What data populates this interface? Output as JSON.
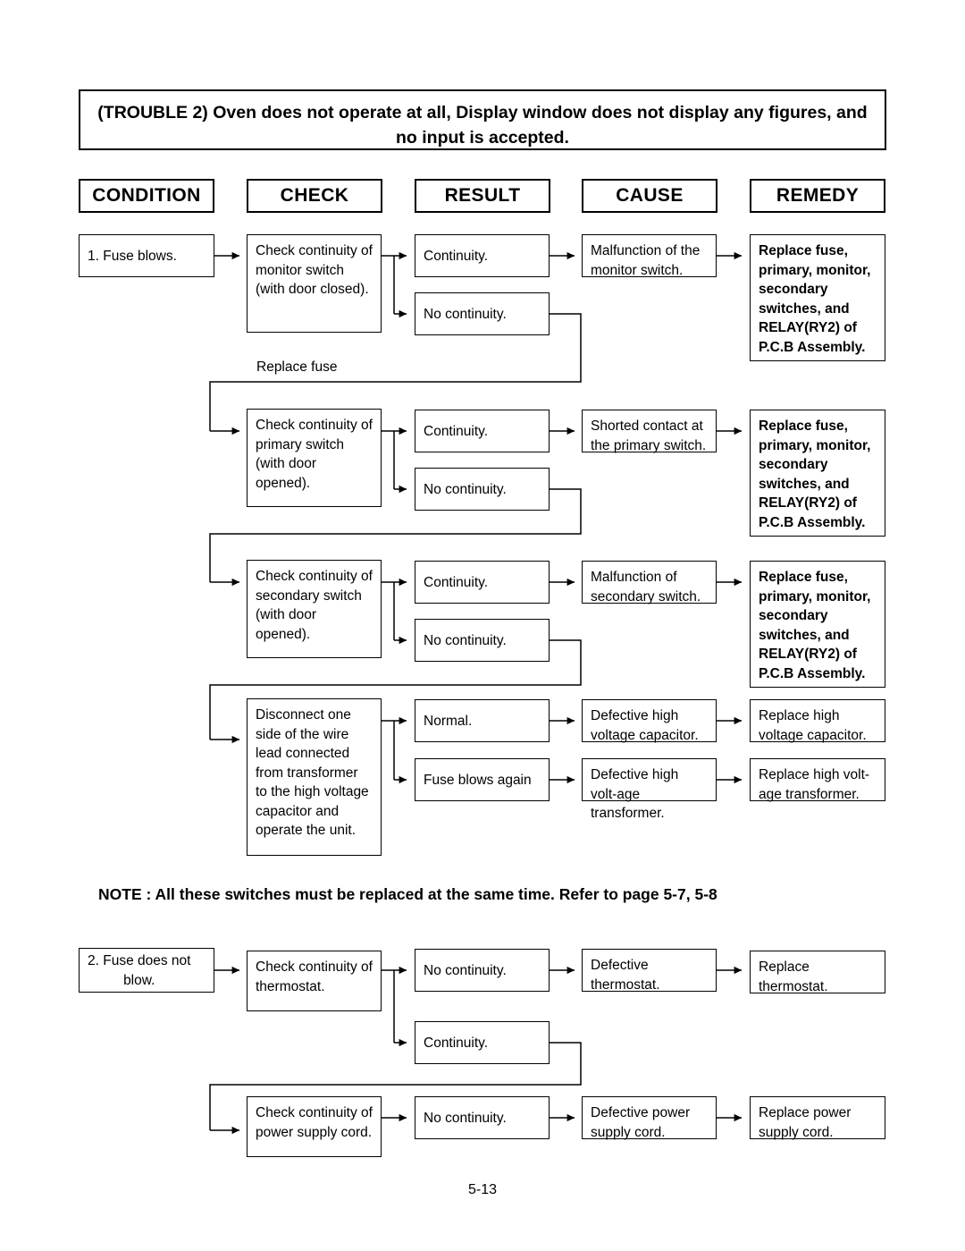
{
  "title": "(TROUBLE 2) Oven does not operate at all, Display window does not display any figures, and no input is accepted.",
  "headers": {
    "condition": "CONDITION",
    "check": "CHECK",
    "result": "RESULT",
    "cause": "CAUSE",
    "remedy": "REMEDY"
  },
  "remedy_switches": "Replace fuse, primary, monitor, secondary switches, and RELAY(RY2) of P.C.B Assembly.",
  "feedback_label": "Replace fuse",
  "note": "NOTE : All these switches must be replaced at the same time. Refer to page 5-7, 5-8",
  "page_number": "5-13",
  "flow": {
    "condition_1": "1. Fuse blows.",
    "condition_2": "2. Fuse does not\n      blow.",
    "rows": [
      {
        "check": "Check continuity of monitor switch (with door closed).",
        "result_top": "Continuity.",
        "result_bottom": "No continuity.",
        "cause": "Malfunction of the monitor switch.",
        "remedy": "Replace fuse, primary, monitor, secondary switches, and RELAY(RY2) of P.C.B Assembly."
      },
      {
        "check": "Check continuity of primary switch (with door opened).",
        "result_top": "Continuity.",
        "result_bottom": "No continuity.",
        "cause": "Shorted contact at the primary switch.",
        "remedy": "Replace fuse, primary, monitor, secondary switches, and RELAY(RY2) of P.C.B Assembly."
      },
      {
        "check": "Check continuity of secondary switch (with door opened).",
        "result_top": "Continuity.",
        "result_bottom": "No continuity.",
        "cause": "Malfunction of secondary switch.",
        "remedy": "Replace fuse, primary, monitor, secondary switches, and RELAY(RY2) of P.C.B Assembly."
      },
      {
        "check": "Disconnect one side of the wire lead connected from transformer to the high voltage capacitor and operate the unit.",
        "result_top": "Normal.",
        "result_bottom": "Fuse blows again",
        "cause_top": "Defective high voltage capacitor.",
        "cause_bottom": "Defective high volt-age transformer.",
        "remedy_top": "Replace high voltage capacitor.",
        "remedy_bottom": "Replace high volt-age transformer."
      },
      {
        "check": "Check continuity of thermostat.",
        "result_top": "No continuity.",
        "result_bottom": "Continuity.",
        "cause": "Defective thermostat.",
        "remedy": "Replace thermostat."
      },
      {
        "check": "Check continuity of power supply cord.",
        "result_top": "No continuity.",
        "cause": "Defective power supply cord.",
        "remedy": "Replace power supply cord."
      }
    ]
  }
}
